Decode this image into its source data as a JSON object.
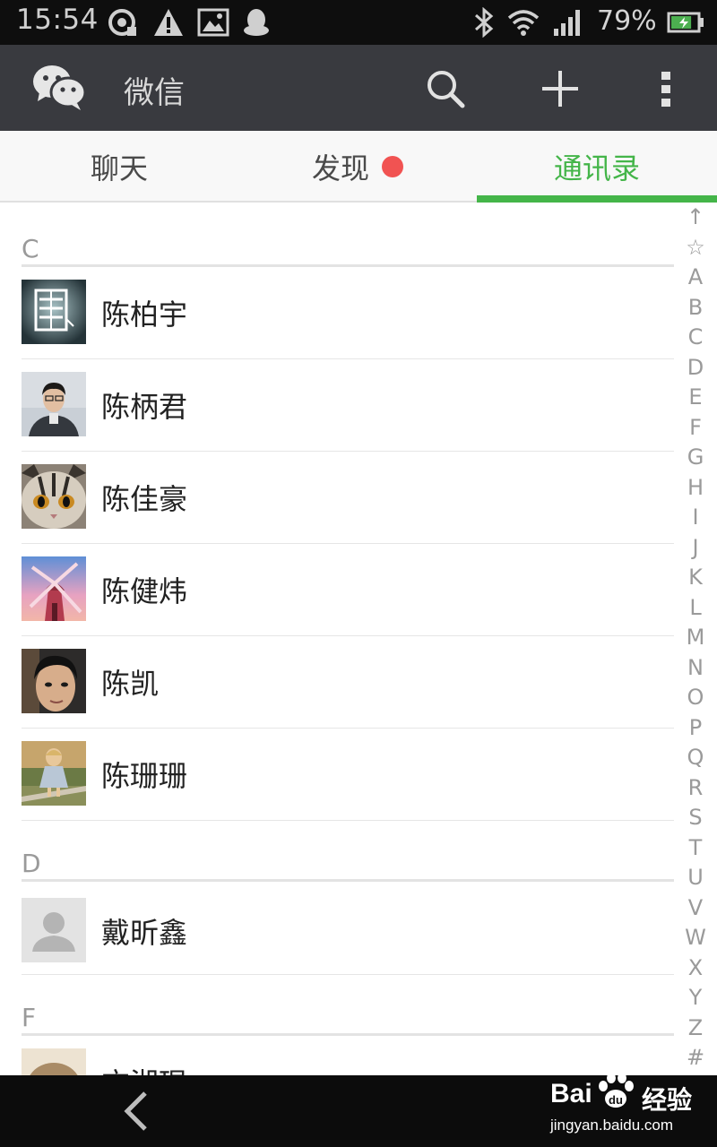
{
  "status_bar": {
    "time": "15:54",
    "battery_percent": "79%",
    "battery_level": 0.79,
    "icons": [
      "data-usage-icon",
      "warning-icon",
      "image-icon",
      "qq-icon",
      "bluetooth-icon",
      "wifi-icon",
      "signal-icon",
      "battery-charging-icon"
    ]
  },
  "app_bar": {
    "title": "微信",
    "icons": [
      "wechat-logo-icon",
      "search-icon",
      "plus-icon",
      "overflow-menu-icon"
    ]
  },
  "tabs": [
    {
      "label": "聊天",
      "active": false,
      "badge": false
    },
    {
      "label": "发现",
      "active": false,
      "badge": true
    },
    {
      "label": "通讯录",
      "active": true,
      "badge": false
    }
  ],
  "colors": {
    "accent": "#44b549",
    "badge": "#f15352",
    "appbar": "#393a3f"
  },
  "contacts": {
    "sections": [
      {
        "letter": "C",
        "items": [
          {
            "name": "陈柏宇",
            "avatar": "photo-poster"
          },
          {
            "name": "陈柄君",
            "avatar": "photo-person"
          },
          {
            "name": "陈佳豪",
            "avatar": "photo-cat"
          },
          {
            "name": "陈健炜",
            "avatar": "photo-windmill"
          },
          {
            "name": "陈凯",
            "avatar": "photo-selfie"
          },
          {
            "name": "陈珊珊",
            "avatar": "photo-child"
          }
        ]
      },
      {
        "letter": "D",
        "items": [
          {
            "name": "戴昕鑫",
            "avatar": "default-avatar"
          }
        ]
      },
      {
        "letter": "F",
        "items": [
          {
            "name": "方湘琨",
            "avatar": "photo-hedgehog"
          }
        ]
      }
    ]
  },
  "index_bar": [
    "↑",
    "☆",
    "A",
    "B",
    "C",
    "D",
    "E",
    "F",
    "G",
    "H",
    "I",
    "J",
    "K",
    "L",
    "M",
    "N",
    "O",
    "P",
    "Q",
    "R",
    "S",
    "T",
    "U",
    "V",
    "W",
    "X",
    "Y",
    "Z",
    "#"
  ],
  "watermark": {
    "brand": "Bai",
    "brand_suffix": "经验",
    "url": "jingyan.baidu.com"
  }
}
